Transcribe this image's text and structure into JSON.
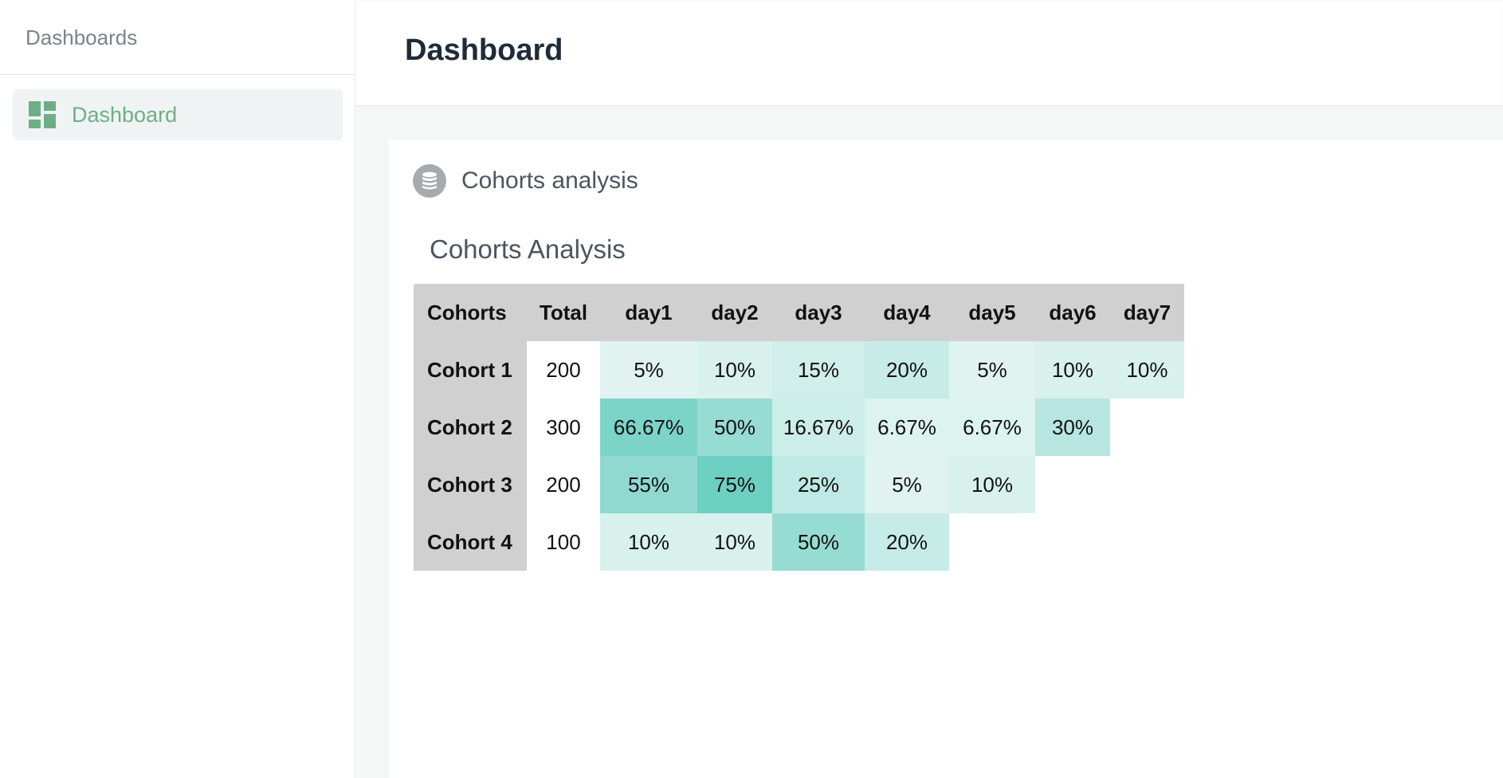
{
  "sidebar": {
    "header": "Dashboards",
    "items": [
      {
        "label": "Dashboard",
        "icon": "dashboard-grid-icon",
        "active": true
      }
    ]
  },
  "header": {
    "title": "Dashboard"
  },
  "card": {
    "icon": "database-icon",
    "title": "Cohorts analysis",
    "chart_title": "Cohorts Analysis"
  },
  "colors": {
    "accent": "#6fae85",
    "header_bg": "#d0d0d0",
    "heat_low": "#e8f6f4",
    "heat_high": "#6ecfc3"
  },
  "chart_data": {
    "type": "table",
    "title": "Cohorts Analysis",
    "columns": [
      "Cohorts",
      "Total",
      "day1",
      "day2",
      "day3",
      "day4",
      "day5",
      "day6",
      "day7"
    ],
    "rows": [
      {
        "cohort": "Cohort 1",
        "total": "200",
        "values": [
          "5%",
          "10%",
          "15%",
          "20%",
          "5%",
          "10%",
          "10%"
        ]
      },
      {
        "cohort": "Cohort 2",
        "total": "300",
        "values": [
          "66.67%",
          "50%",
          "16.67%",
          "6.67%",
          "6.67%",
          "30%"
        ]
      },
      {
        "cohort": "Cohort 3",
        "total": "200",
        "values": [
          "55%",
          "75%",
          "25%",
          "5%",
          "10%"
        ]
      },
      {
        "cohort": "Cohort 4",
        "total": "100",
        "values": [
          "10%",
          "10%",
          "50%",
          "20%"
        ]
      }
    ]
  }
}
